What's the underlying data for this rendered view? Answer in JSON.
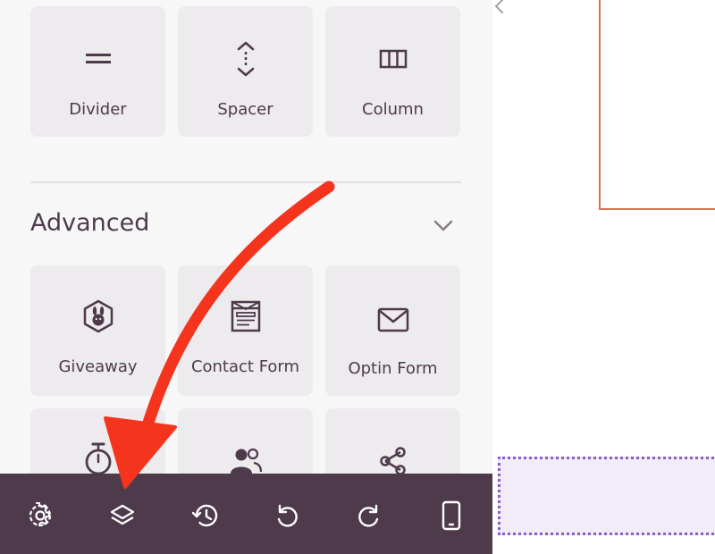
{
  "layout_blocks": [
    {
      "label": "Divider",
      "icon": "divider-icon"
    },
    {
      "label": "Spacer",
      "icon": "spacer-icon"
    },
    {
      "label": "Column",
      "icon": "column-icon"
    }
  ],
  "advanced": {
    "title": "Advanced",
    "chevron_icon": "chevron-down-icon",
    "blocks": [
      {
        "label": "Giveaway",
        "icon": "giveaway-icon"
      },
      {
        "label": "Contact Form",
        "icon": "contact-form-icon"
      },
      {
        "label": "Optin Form",
        "icon": "envelope-icon"
      },
      {
        "label": "",
        "icon": "stopwatch-icon"
      },
      {
        "label": "",
        "icon": "users-icon"
      },
      {
        "label": "",
        "icon": "share-icon"
      }
    ]
  },
  "toolbar": {
    "buttons": [
      "settings-icon",
      "layers-icon",
      "history-icon",
      "undo-icon",
      "redo-icon",
      "mobile-preview-icon"
    ]
  },
  "colors": {
    "panel_bg": "#f8f7f8",
    "tile_bg": "#edebed",
    "text": "#4e3a4b",
    "toolbar_bg": "#4e3a4b",
    "annotation_arrow": "#f5341d",
    "canvas_block_border": "#d9704f",
    "drop_zone_border": "#8b5bc8",
    "drop_zone_bg": "#f2ecf8"
  }
}
